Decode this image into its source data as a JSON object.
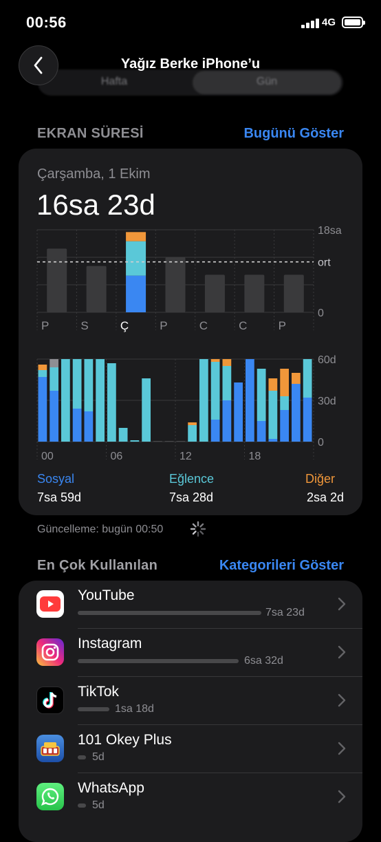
{
  "status": {
    "time": "00:56",
    "network": "4G"
  },
  "nav": {
    "title": "Yağız Berke iPhone’u",
    "segments": [
      "Hafta",
      "Gün"
    ],
    "selected": "Gün"
  },
  "screen_time": {
    "section_title": "EKRAN SÜRESİ",
    "show_today": "Bugünü Göster",
    "date": "Çarşamba, 1 Ekim",
    "total": "16sa 23d",
    "weekly_chart": {
      "y_labels": [
        "18sa",
        "ort",
        "0"
      ],
      "days": [
        "P",
        "S",
        "Ç",
        "P",
        "C",
        "C",
        "P"
      ],
      "selected_day": "Ç",
      "values_hours": [
        13.9,
        10.1,
        16.4,
        12.0,
        8.2,
        8.2,
        8.2
      ],
      "selected_breakdown_hours": {
        "Sosyal": 8.0,
        "Eğlence": 7.5,
        "Diğer": 2.0
      },
      "average_hours": 11.0,
      "max_hours": 18
    },
    "hourly_chart": {
      "y_labels": [
        "60d",
        "30d",
        "0"
      ],
      "x_labels": [
        "00",
        "06",
        "12",
        "18"
      ],
      "hours": [
        {
          "s": 47,
          "e": 5,
          "o": 4,
          "g": 0
        },
        {
          "s": 37,
          "e": 17,
          "o": 0,
          "g": 6
        },
        {
          "s": 0,
          "e": 60,
          "o": 0,
          "g": 0
        },
        {
          "s": 24,
          "e": 36,
          "o": 0,
          "g": 0
        },
        {
          "s": 22,
          "e": 38,
          "o": 0,
          "g": 0
        },
        {
          "s": 0,
          "e": 60,
          "o": 0,
          "g": 0
        },
        {
          "s": 0,
          "e": 57,
          "o": 0,
          "g": 0
        },
        {
          "s": 0,
          "e": 10,
          "o": 0,
          "g": 0
        },
        {
          "s": 0,
          "e": 1,
          "o": 0,
          "g": 0
        },
        {
          "s": 0,
          "e": 46,
          "o": 0,
          "g": 0
        },
        {
          "s": 0,
          "e": 0,
          "o": 0,
          "g": 0
        },
        {
          "s": 0,
          "e": 0,
          "o": 0,
          "g": 0
        },
        {
          "s": 0,
          "e": 0,
          "o": 0,
          "g": 0
        },
        {
          "s": 0,
          "e": 12,
          "o": 2,
          "g": 0
        },
        {
          "s": 0,
          "e": 60,
          "o": 0,
          "g": 0
        },
        {
          "s": 16,
          "e": 42,
          "o": 2,
          "g": 0
        },
        {
          "s": 30,
          "e": 25,
          "o": 5,
          "g": 0
        },
        {
          "s": 43,
          "e": 0,
          "o": 0,
          "g": 0
        },
        {
          "s": 60,
          "e": 0,
          "o": 0,
          "g": 0
        },
        {
          "s": 15,
          "e": 38,
          "o": 0,
          "g": 0
        },
        {
          "s": 2,
          "e": 35,
          "o": 9,
          "g": 0
        },
        {
          "s": 23,
          "e": 10,
          "o": 20,
          "g": 0
        },
        {
          "s": 42,
          "e": 0,
          "o": 8,
          "g": 0
        },
        {
          "s": 32,
          "e": 28,
          "o": 0,
          "g": 0
        }
      ]
    },
    "legend": [
      {
        "name": "Sosyal",
        "value": "7sa 59d",
        "color": "#3a87f2"
      },
      {
        "name": "Eğlence",
        "value": "7sa 28d",
        "color": "#5ac8d8"
      },
      {
        "name": "Diğer",
        "value": "2sa 2d",
        "color": "#f0973a"
      }
    ],
    "updated": "Güncelleme: bugün 00:50"
  },
  "most_used": {
    "section_title": "En Çok Kullanılan",
    "show_categories": "Kategorileri Göster",
    "apps": [
      {
        "name": "YouTube",
        "duration": "7sa 23d",
        "fraction": 1.0,
        "icon": "youtube-icon"
      },
      {
        "name": "Instagram",
        "duration": "6sa 32d",
        "fraction": 0.88,
        "icon": "instagram-icon"
      },
      {
        "name": "TikTok",
        "duration": "1sa 18d",
        "fraction": 0.18,
        "icon": "tiktok-icon"
      },
      {
        "name": "101 Okey Plus",
        "duration": "5d",
        "fraction": 0.02,
        "icon": "okey-plus-icon"
      },
      {
        "name": "WhatsApp",
        "duration": "5d",
        "fraction": 0.02,
        "icon": "whatsapp-icon"
      }
    ]
  },
  "colors": {
    "social": "#3a87f2",
    "entertainment": "#5ac8d8",
    "other": "#f0973a",
    "gray_bar": "#3a3a3c",
    "accent": "#3a87f2"
  }
}
